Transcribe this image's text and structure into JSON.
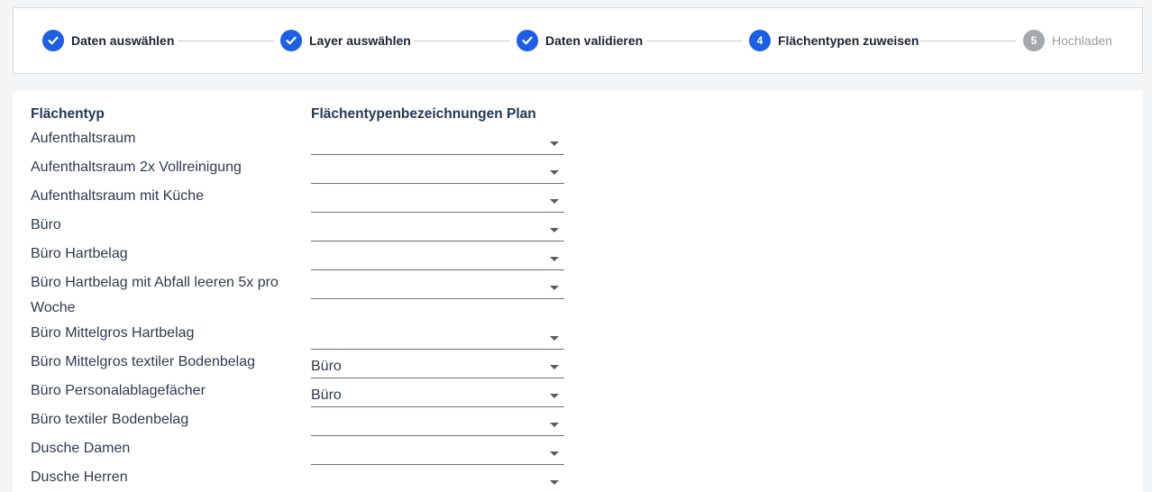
{
  "stepper": {
    "steps": [
      {
        "label": "Daten auswählen",
        "state": "done",
        "number": ""
      },
      {
        "label": "Layer auswählen",
        "state": "done",
        "number": ""
      },
      {
        "label": "Daten validieren",
        "state": "done",
        "number": ""
      },
      {
        "label": "Flächentypen zuweisen",
        "state": "active",
        "number": "4"
      },
      {
        "label": "Hochladen",
        "state": "pending",
        "number": "5"
      }
    ]
  },
  "table": {
    "col_type_header": "Flächentyp",
    "col_plan_header": "Flächentypenbezeichnungen Plan",
    "rows": [
      {
        "type": "Aufenthaltsraum",
        "plan": ""
      },
      {
        "type": "Aufenthaltsraum 2x Vollreinigung",
        "plan": ""
      },
      {
        "type": "Aufenthaltsraum mit Küche",
        "plan": ""
      },
      {
        "type": "Büro",
        "plan": ""
      },
      {
        "type": "Büro Hartbelag",
        "plan": ""
      },
      {
        "type": "Büro Hartbelag mit Abfall leeren 5x pro Woche",
        "plan": ""
      },
      {
        "type": "Büro Mittelgros Hartbelag",
        "plan": ""
      },
      {
        "type": "Büro Mittelgros textiler Bodenbelag",
        "plan": "Büro"
      },
      {
        "type": "Büro Personalablagefächer",
        "plan": "Büro"
      },
      {
        "type": "Büro textiler Bodenbelag",
        "plan": ""
      },
      {
        "type": "Dusche Damen",
        "plan": ""
      },
      {
        "type": "Dusche Herren",
        "plan": ""
      }
    ]
  },
  "colors": {
    "accent": "#1b5fe6",
    "pending": "#a4a7ab",
    "background": "#f4f5f7"
  }
}
